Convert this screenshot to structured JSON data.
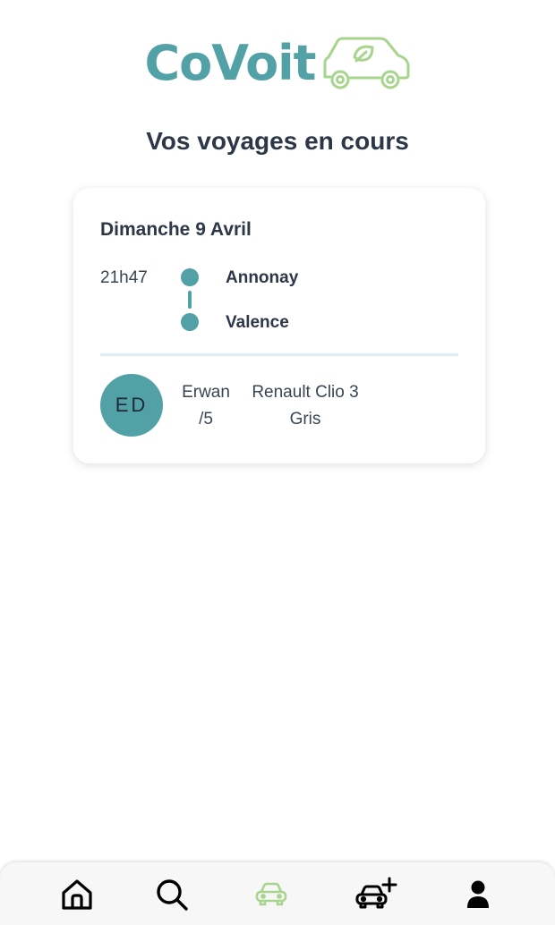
{
  "app": {
    "name": "CoVoit",
    "brand_color": "#52a1a6",
    "accent_color": "#a8d58e"
  },
  "page": {
    "title": "Vos voyages en cours"
  },
  "trip": {
    "date": "Dimanche 9 Avril",
    "time": "21h47",
    "from": "Annonay",
    "to": "Valence",
    "driver": {
      "initials": "ED",
      "name": "Erwan",
      "rating": "/5"
    },
    "car": {
      "model": "Renault Clio 3",
      "color": "Gris"
    }
  },
  "nav": {
    "items": [
      {
        "icon": "home-icon",
        "active": false
      },
      {
        "icon": "search-icon",
        "active": false
      },
      {
        "icon": "car-icon",
        "active": true
      },
      {
        "icon": "car-plus-icon",
        "active": false
      },
      {
        "icon": "user-icon",
        "active": false
      }
    ]
  }
}
